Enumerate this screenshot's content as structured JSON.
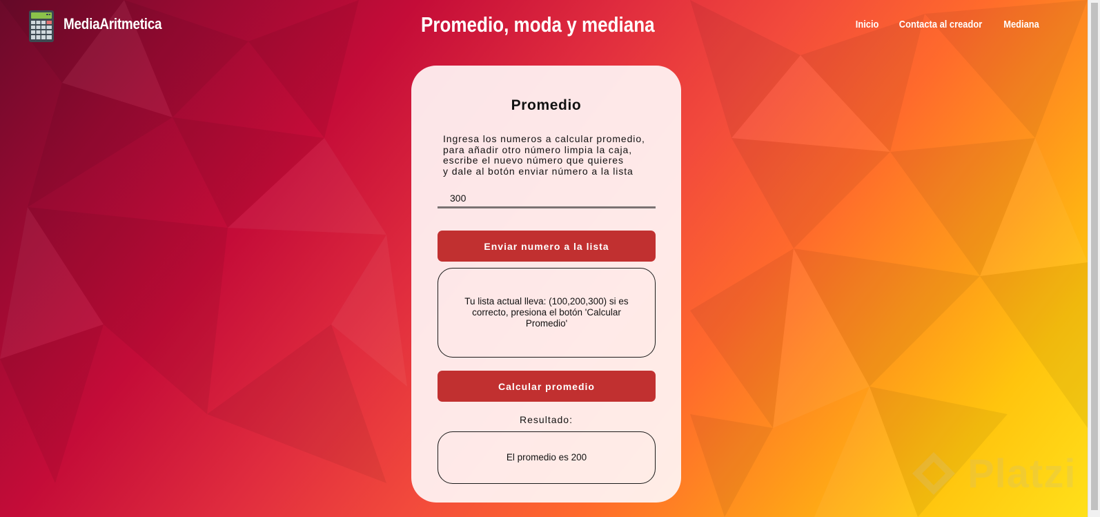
{
  "header": {
    "brand": "MediaAritmetica",
    "title": "Promedio, moda y mediana",
    "nav": [
      "Inicio",
      "Contacta al creador",
      "Mediana"
    ]
  },
  "card": {
    "heading": "Promedio",
    "instructions": [
      "Ingresa los numeros a calcular promedio,",
      "para añadir otro número limpia la caja,",
      "escribe el nuevo número que quieres",
      "y dale al botón enviar número a la lista"
    ],
    "input_value": "300",
    "send_button": "Enviar numero a la lista",
    "list_text": "Tu lista actual lleva: (100,200,300) si es correcto, presiona el botón 'Calcular Promedio'",
    "calc_button": "Calcular promedio",
    "result_label": "Resultado:",
    "result_text": "El promedio es 200"
  },
  "watermark": "Platzi",
  "colors": {
    "button": "#c13030",
    "card_bg": "#fff5f5",
    "header_text": "#ffffff"
  },
  "icons": {
    "logo": "calculator-icon",
    "watermark": "platzi-logo-icon"
  }
}
